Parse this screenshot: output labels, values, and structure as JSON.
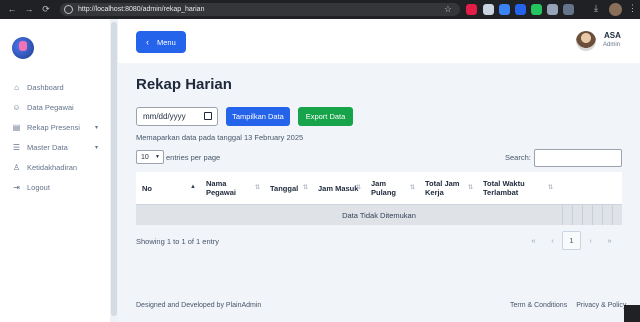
{
  "browser": {
    "nav_back": "←",
    "nav_forward": "→",
    "nav_reload": "⟳",
    "url": "http://localhost:8080/admin/rekap_harian",
    "star_icon": "star-icon",
    "download_icon": "download-icon",
    "menu_icon": "⋮"
  },
  "sidebar": {
    "items": [
      {
        "label": "Dashboard",
        "icon": "⌂",
        "has_children": false
      },
      {
        "label": "Data Pegawai",
        "icon": "☺",
        "has_children": false
      },
      {
        "label": "Rekap Presensi",
        "icon": "▤",
        "has_children": true
      },
      {
        "label": "Master Data",
        "icon": "☰",
        "has_children": true
      },
      {
        "label": "Ketidakhadiran",
        "icon": "♙",
        "has_children": false
      },
      {
        "label": "Logout",
        "icon": "⇥",
        "has_children": false
      }
    ],
    "caret": "▾"
  },
  "header": {
    "menu_button_label": "Menu",
    "menu_button_icon": "‹",
    "user_name": "ASA",
    "user_role": "Admin"
  },
  "main": {
    "title": "Rekap Harian",
    "date_input_placeholder": "mm/dd/yyyy",
    "show_button": "Tampilkan Data",
    "export_button": "Export Data",
    "description": "Memaparkan data pada tanggal 13 February 2025",
    "page_length_value": "10",
    "page_length_suffix": "entries per page",
    "search_label": "Search:",
    "table": {
      "columns": [
        {
          "label": "No",
          "sorted": true
        },
        {
          "label": "Nama Pegawai",
          "sorted": false
        },
        {
          "label": "Tanggal",
          "sorted": false
        },
        {
          "label": "Jam Masuk",
          "sorted": false
        },
        {
          "label": "Jam Pulang",
          "sorted": false
        },
        {
          "label": "Total Jam Kerja",
          "sorted": false
        },
        {
          "label": "Total Waktu Terlambat",
          "sorted": false
        }
      ],
      "empty_message": "Data Tidak Ditemukan"
    },
    "info_text": "Showing 1 to 1 of 1 entry",
    "pagination": {
      "first": "«",
      "prev": "‹",
      "current": "1",
      "next": "›",
      "last": "»"
    }
  },
  "footer": {
    "credit": "Designed and Developed by PlainAdmin",
    "terms": "Term & Conditions",
    "privacy": "Privacy & Policy"
  },
  "colors": {
    "primary": "#2563eb",
    "success": "#16a34a",
    "background": "#f1f5f9"
  }
}
